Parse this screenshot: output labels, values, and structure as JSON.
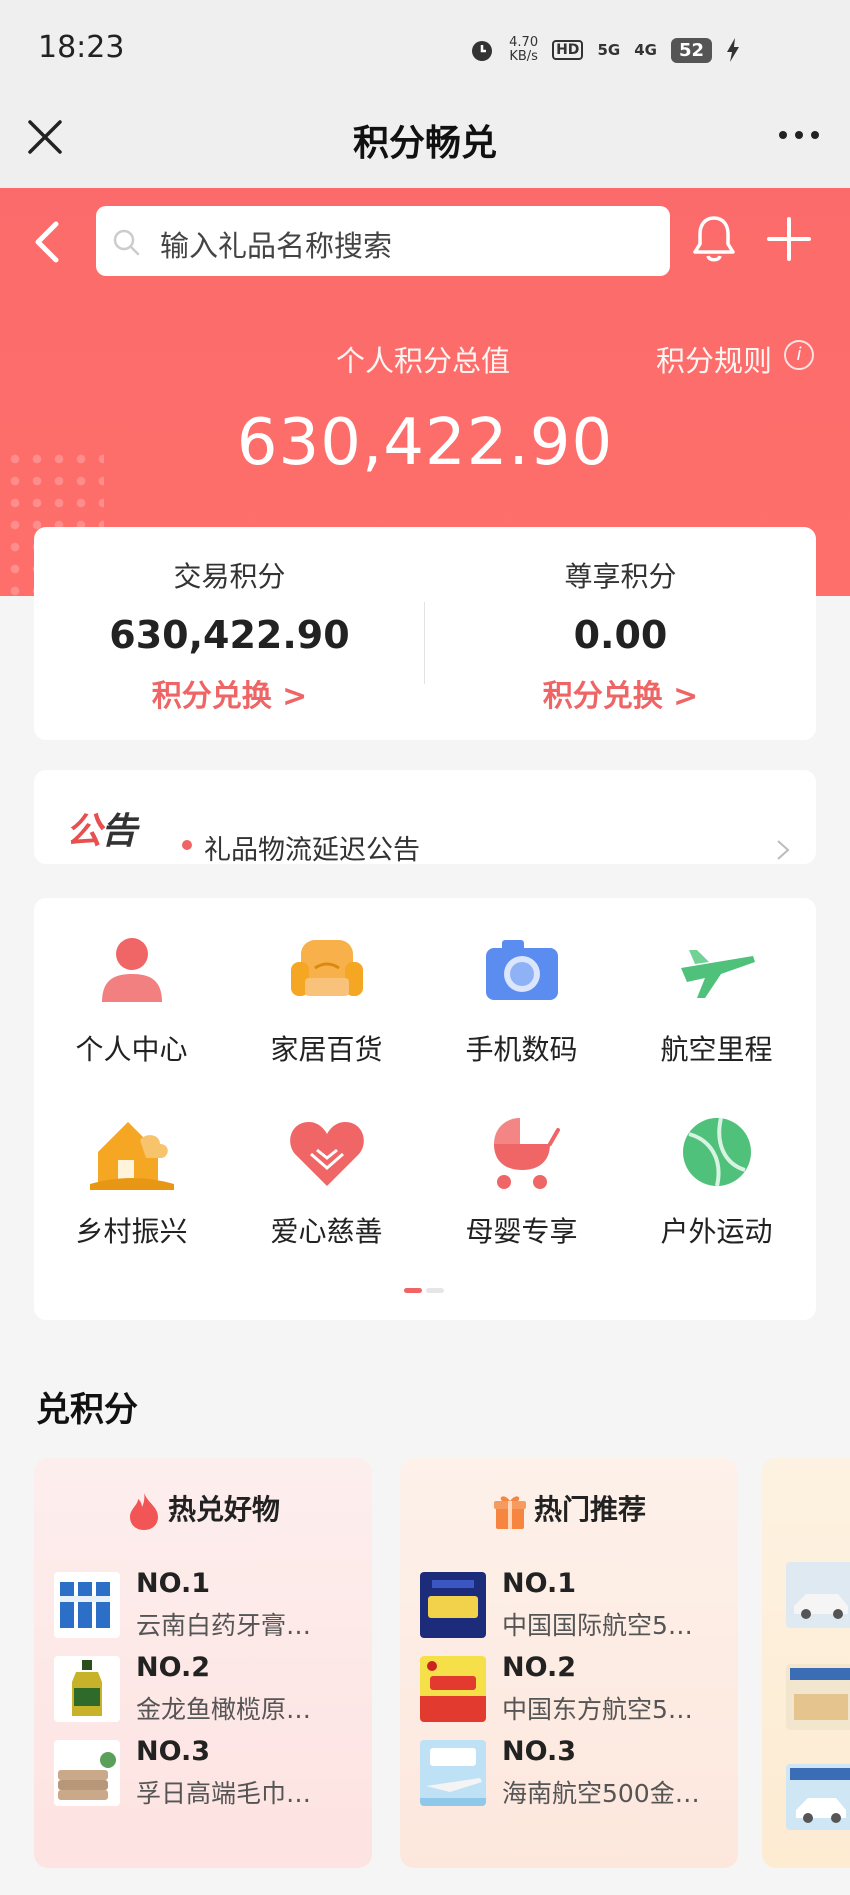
{
  "status_bar": {
    "time": "18:23",
    "net_speed": "4.70",
    "net_unit": "KB/s",
    "hd": "HD",
    "sig1": "5G",
    "sig2": "4G",
    "battery": "52"
  },
  "title_bar": {
    "title": "积分畅兑"
  },
  "search": {
    "placeholder": "输入礼品名称搜索"
  },
  "points": {
    "total_label": "个人积分总值",
    "rules_label": "积分规则",
    "info_glyph": "i",
    "total_value": "630,422.90",
    "trade": {
      "label": "交易积分",
      "value": "630,422.90",
      "action": "积分兑换 >"
    },
    "vip": {
      "label": "尊享积分",
      "value": "0.00",
      "action": "积分兑换 >"
    }
  },
  "notice": {
    "logo_a": "公",
    "logo_b": "告",
    "text": "礼品物流延迟公告"
  },
  "categories": [
    {
      "label": "个人中心",
      "icon": "person-icon",
      "color": "#f06565"
    },
    {
      "label": "家居百货",
      "icon": "sofa-icon",
      "color": "#f5a623"
    },
    {
      "label": "手机数码",
      "icon": "camera-icon",
      "color": "#5b8cf0"
    },
    {
      "label": "航空里程",
      "icon": "airplane-icon",
      "color": "#4fc17a"
    },
    {
      "label": "乡村振兴",
      "icon": "house-icon",
      "color": "#f5a623"
    },
    {
      "label": "爱心慈善",
      "icon": "heart-icon",
      "color": "#f06565"
    },
    {
      "label": "母婴专享",
      "icon": "stroller-icon",
      "color": "#f06565"
    },
    {
      "label": "户外运动",
      "icon": "ball-icon",
      "color": "#4fc17a"
    }
  ],
  "exchange_section": {
    "title": "兑积分"
  },
  "hot_goods": {
    "title": "热兑好物",
    "items": [
      {
        "rank": "NO.1",
        "name": "云南白药牙膏…"
      },
      {
        "rank": "NO.2",
        "name": "金龙鱼橄榄原…"
      },
      {
        "rank": "NO.3",
        "name": "孚日高端毛巾…"
      }
    ]
  },
  "hot_recommend": {
    "title": "热门推荐",
    "items": [
      {
        "rank": "NO.1",
        "name": "中国国际航空5…"
      },
      {
        "rank": "NO.2",
        "name": "中国东方航空5…"
      },
      {
        "rank": "NO.3",
        "name": "海南航空500金…"
      }
    ]
  }
}
